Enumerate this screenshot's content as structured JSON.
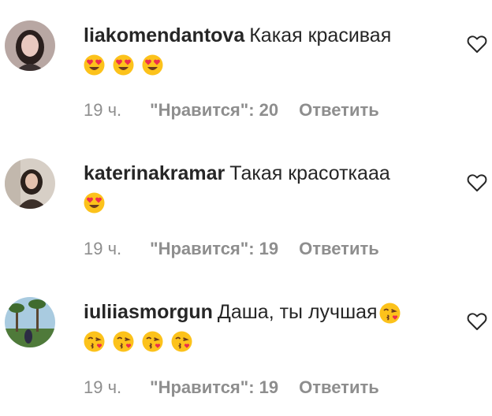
{
  "comments": [
    {
      "username": "liakomendantova",
      "text": "Какая красивая",
      "emojis": [
        "heart-eyes",
        "heart-eyes",
        "heart-eyes"
      ],
      "time": "19 ч.",
      "likes": "\"Нравится\": 20",
      "reply": "Ответить"
    },
    {
      "username": "katerinakramar",
      "text": "Такая красоткааа",
      "emojis": [
        "heart-eyes"
      ],
      "time": "19 ч.",
      "likes": "\"Нравится\": 19",
      "reply": "Ответить"
    },
    {
      "username": "iuliiasmorgun",
      "text": "Даша, ты лучшая",
      "emojis": [
        "kiss-heart",
        "kiss-heart",
        "kiss-heart",
        "kiss-heart",
        "kiss-heart"
      ],
      "time": "19 ч.",
      "likes": "\"Нравится\": 19",
      "reply": "Ответить"
    }
  ],
  "colors": {
    "text": "#262626",
    "meta": "#8e8e8e",
    "emoji_face": "#fcc21b",
    "emoji_heart": "#ed2e4b"
  }
}
